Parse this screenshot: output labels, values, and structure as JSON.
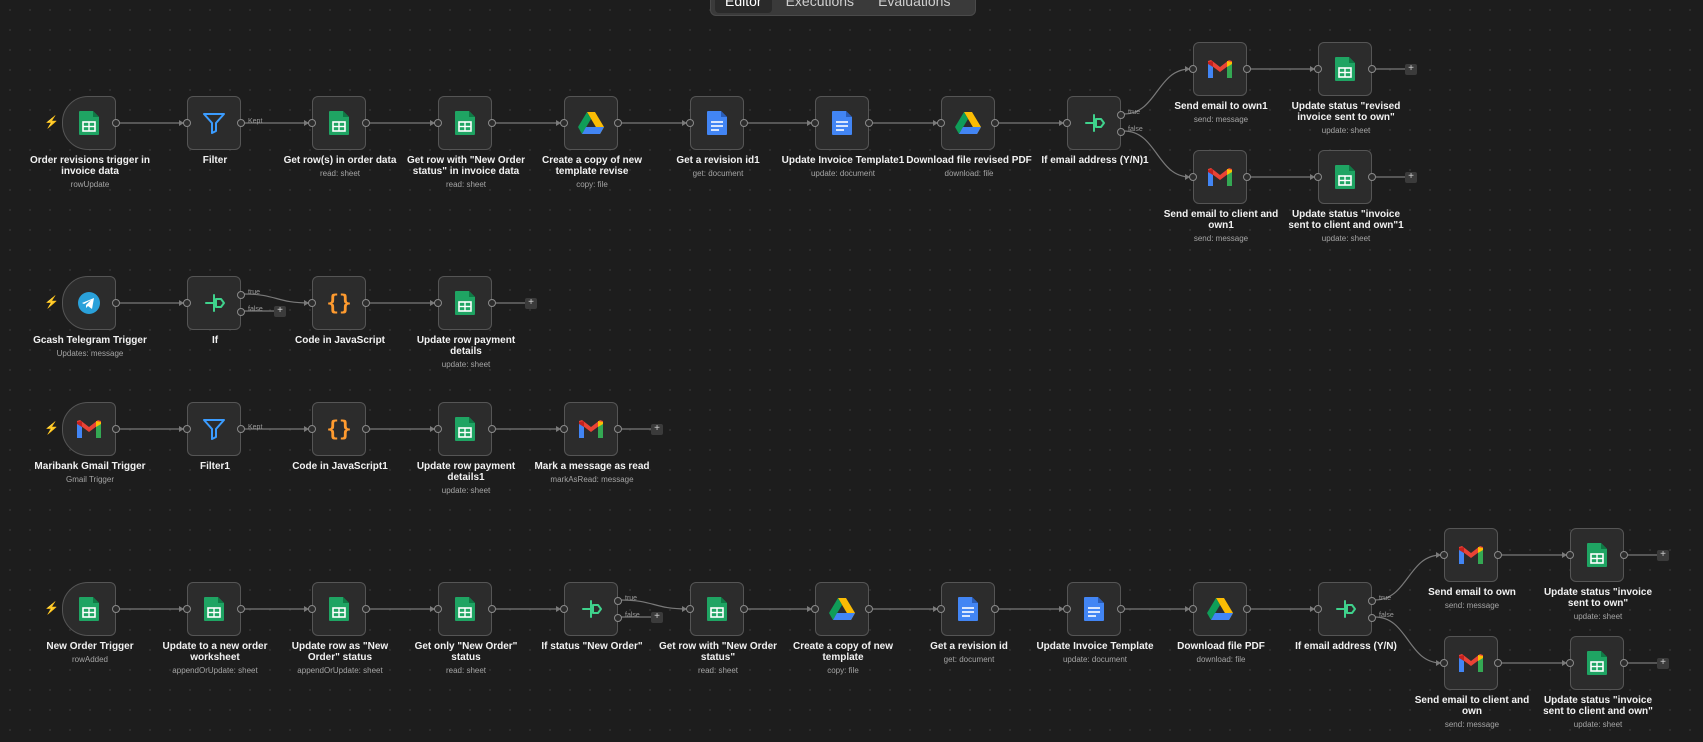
{
  "tabs": [
    {
      "label": "Editor",
      "active": true
    },
    {
      "label": "Executions"
    },
    {
      "label": "Evaluations"
    }
  ],
  "icons": {
    "sheets": "google-sheets-icon",
    "filter": "filter-icon",
    "if": "if-branch-icon",
    "code": "code-braces-icon",
    "drive": "google-drive-icon",
    "docs": "google-docs-icon",
    "gmail": "gmail-icon",
    "telegram": "telegram-icon"
  },
  "colors": {
    "trigger_bolt": "#ff6d5a",
    "sheets": "#1fa463",
    "filter": "#3b9cff",
    "if": "#3fd28c",
    "code": "#ff9b2f",
    "docs": "#4285f4",
    "gmail_red": "#ea4335",
    "telegram": "#2aa1da",
    "edge": "#7a7a7a"
  },
  "nodes": [
    {
      "id": "n1",
      "icon": "sheets",
      "trigger": true,
      "name": "Order revisions trigger in invoice data",
      "sub": "rowUpdate"
    },
    {
      "id": "n2",
      "icon": "filter",
      "name": "Filter",
      "sub": ""
    },
    {
      "id": "n3",
      "icon": "sheets",
      "name": "Get row(s) in order data",
      "sub": "read: sheet"
    },
    {
      "id": "n4",
      "icon": "sheets",
      "name": "Get row with \"New Order status\" in invoice data",
      "sub": "read: sheet"
    },
    {
      "id": "n5",
      "icon": "drive",
      "name": "Create a copy of new template revise",
      "sub": "copy: file"
    },
    {
      "id": "n6",
      "icon": "docs",
      "name": "Get a revision id1",
      "sub": "get: document"
    },
    {
      "id": "n7",
      "icon": "docs",
      "name": "Update Invoice Template1",
      "sub": "update: document"
    },
    {
      "id": "n8",
      "icon": "drive",
      "name": "Download file revised PDF",
      "sub": "download: file"
    },
    {
      "id": "n9",
      "icon": "if",
      "name": "If email address (Y/N)1",
      "sub": ""
    },
    {
      "id": "n10",
      "icon": "gmail",
      "name": "Send email to own1",
      "sub": "send: message"
    },
    {
      "id": "n11",
      "icon": "sheets",
      "name": "Update status \"revised invoice sent to own\"",
      "sub": "update: sheet"
    },
    {
      "id": "n12",
      "icon": "gmail",
      "name": "Send email to client and own1",
      "sub": "send: message"
    },
    {
      "id": "n13",
      "icon": "sheets",
      "name": "Update status \"invoice sent to client and own\"1",
      "sub": "update: sheet"
    },
    {
      "id": "n14",
      "icon": "telegram",
      "trigger": true,
      "name": "Gcash Telegram Trigger",
      "sub": "Updates: message"
    },
    {
      "id": "n15",
      "icon": "if",
      "name": "If",
      "sub": ""
    },
    {
      "id": "n16",
      "icon": "code",
      "name": "Code in JavaScript",
      "sub": ""
    },
    {
      "id": "n17",
      "icon": "sheets",
      "name": "Update row payment details",
      "sub": "update: sheet"
    },
    {
      "id": "n18",
      "icon": "gmail",
      "trigger": true,
      "name": "Maribank Gmail Trigger",
      "sub": "Gmail Trigger"
    },
    {
      "id": "n19",
      "icon": "filter",
      "name": "Filter1",
      "sub": ""
    },
    {
      "id": "n20",
      "icon": "code",
      "name": "Code in JavaScript1",
      "sub": ""
    },
    {
      "id": "n21",
      "icon": "sheets",
      "name": "Update row payment details1",
      "sub": "update: sheet"
    },
    {
      "id": "n22",
      "icon": "gmail",
      "name": "Mark a message as read",
      "sub": "markAsRead: message"
    },
    {
      "id": "n23",
      "icon": "sheets",
      "trigger": true,
      "name": "New Order Trigger",
      "sub": "rowAdded"
    },
    {
      "id": "n24",
      "icon": "sheets",
      "name": "Update to a new order worksheet",
      "sub": "appendOrUpdate: sheet"
    },
    {
      "id": "n25",
      "icon": "sheets",
      "name": "Update row as \"New Order\" status",
      "sub": "appendOrUpdate: sheet"
    },
    {
      "id": "n26",
      "icon": "sheets",
      "name": "Get only \"New Order\" status",
      "sub": "read: sheet"
    },
    {
      "id": "n27",
      "icon": "if",
      "name": "If status \"New Order\"",
      "sub": ""
    },
    {
      "id": "n28",
      "icon": "sheets",
      "name": "Get row with \"New Order status\"",
      "sub": "read: sheet"
    },
    {
      "id": "n29",
      "icon": "drive",
      "name": "Create a copy of new template",
      "sub": "copy: file"
    },
    {
      "id": "n30",
      "icon": "docs",
      "name": "Get a revision id",
      "sub": "get: document"
    },
    {
      "id": "n31",
      "icon": "docs",
      "name": "Update Invoice Template",
      "sub": "update: document"
    },
    {
      "id": "n32",
      "icon": "drive",
      "name": "Download file PDF",
      "sub": "download: file"
    },
    {
      "id": "n33",
      "icon": "if",
      "name": "If email address (Y/N)",
      "sub": ""
    },
    {
      "id": "n34",
      "icon": "gmail",
      "name": "Send email to own",
      "sub": "send: message"
    },
    {
      "id": "n35",
      "icon": "sheets",
      "name": "Update status \"invoice sent to own\"",
      "sub": "update: sheet"
    },
    {
      "id": "n36",
      "icon": "gmail",
      "name": "Send email to client and own",
      "sub": "send: message"
    },
    {
      "id": "n37",
      "icon": "sheets",
      "name": "Update status \"invoice sent to client and own\"",
      "sub": "update: sheet"
    }
  ],
  "edge_labels": {
    "kept": "Kept",
    "true": "true",
    "false": "false"
  },
  "plus_label": "+",
  "trigger_symbol": "⚡"
}
